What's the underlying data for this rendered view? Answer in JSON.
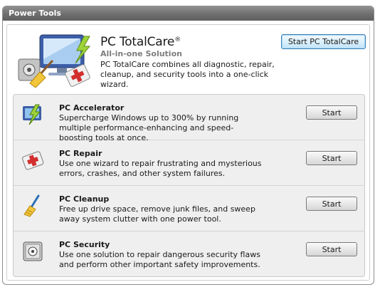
{
  "panel": {
    "title": "Power Tools"
  },
  "hero": {
    "title": "PC TotalCare",
    "trademark": "®",
    "subtitle": "All-in-one Solution",
    "description": "PC TotalCare combines all diagnostic, repair, cleanup, and security tools into a one-click wizard.",
    "start_button": "Start PC TotalCare",
    "icon": "pc-totalcare-monitor-icon"
  },
  "tools": [
    {
      "id": "accelerator",
      "title": "PC Accelerator",
      "description": "Supercharge Windows up to 300% by running multiple performance-enhancing and speed-boosting tools at once.",
      "button": "Start",
      "icon": "lightning-monitor-icon"
    },
    {
      "id": "repair",
      "title": "PC Repair",
      "description": "Use one wizard to repair frustrating and mysterious errors, crashes, and other system failures.",
      "button": "Start",
      "icon": "first-aid-kit-icon"
    },
    {
      "id": "cleanup",
      "title": "PC Cleanup",
      "description": "Free up drive space, remove junk files, and sweep away system clutter with one power tool.",
      "button": "Start",
      "icon": "broom-icon"
    },
    {
      "id": "security",
      "title": "PC Security",
      "description": "Use one solution to repair dangerous security flaws and perform other important safety improvements.",
      "button": "Start",
      "icon": "safe-icon"
    }
  ],
  "colors": {
    "header": "#6e6e6e",
    "accent": "#3c7fb1",
    "tool_bg": "#efefef"
  }
}
